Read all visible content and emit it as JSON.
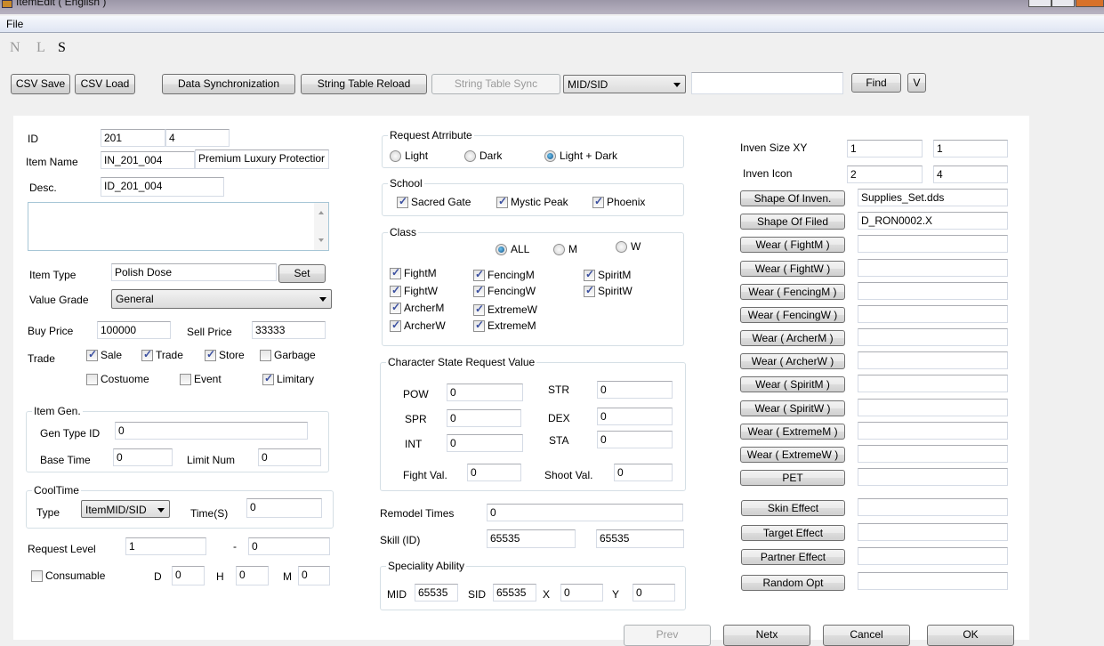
{
  "window": {
    "title": "ItemEdit ( English )"
  },
  "menu": {
    "file": "File"
  },
  "mode": {
    "n": "N",
    "l": "L",
    "s": "S"
  },
  "toolbar": {
    "csv_save": "CSV Save",
    "csv_load": "CSV Load",
    "data_sync": "Data Synchronization",
    "string_reload": "String Table Reload",
    "string_sync": "String Table Sync",
    "search_type": "MID/SID",
    "search_value": "",
    "find": "Find",
    "v": "V"
  },
  "left": {
    "id_label": "ID",
    "id_main": "201",
    "id_sub": "4",
    "name_label": "Item Name",
    "name_key": "IN_201_004",
    "name_value": "Premium Luxury Protectior",
    "desc_label": "Desc.",
    "desc_key": "ID_201_004",
    "desc_text": "",
    "type_label": "Item Type",
    "type_value": "Polish Dose",
    "set": "Set",
    "grade_label": "Value Grade",
    "grade_value": "General",
    "buy_label": "Buy Price",
    "buy_value": "100000",
    "sell_label": "Sell Price",
    "sell_value": "33333",
    "trade_label": "Trade",
    "trade": [
      {
        "label": "Sale",
        "checked": true
      },
      {
        "label": "Trade",
        "checked": true
      },
      {
        "label": "Store",
        "checked": true
      },
      {
        "label": "Garbage",
        "checked": false
      },
      {
        "label": "Costuome",
        "checked": false
      },
      {
        "label": "Event",
        "checked": false
      },
      {
        "label": "Limitary",
        "checked": true
      }
    ],
    "gen": {
      "title": "Item Gen.",
      "gen_type_label": "Gen Type ID",
      "gen_type": "0",
      "base_time_label": "Base Time",
      "base_time": "0",
      "limit_label": "Limit Num",
      "limit": "0"
    },
    "cool": {
      "title": "CoolTime",
      "type_label": "Type",
      "type_value": "ItemMID/SID",
      "time_label": "Time(S)",
      "time": "0"
    },
    "req_level_label": "Request Level",
    "req_level_min": "1",
    "dash": "-",
    "req_level_max": "0",
    "consumable": {
      "label": "Consumable",
      "checked": false
    },
    "d_label": "D",
    "d": "0",
    "h_label": "H",
    "h": "0",
    "m_label": "M",
    "m": "0"
  },
  "middle": {
    "attr": {
      "title": "Request Atrribute",
      "options": [
        {
          "label": "Light",
          "selected": false
        },
        {
          "label": "Dark",
          "selected": false
        },
        {
          "label": "Light + Dark",
          "selected": true
        }
      ]
    },
    "school": {
      "title": "School",
      "items": [
        {
          "label": "Sacred Gate",
          "checked": true
        },
        {
          "label": "Mystic Peak",
          "checked": true
        },
        {
          "label": "Phoenix",
          "checked": true
        }
      ]
    },
    "class": {
      "title": "Class",
      "gender": [
        {
          "label": "ALL",
          "selected": true
        },
        {
          "label": "M",
          "selected": false
        },
        {
          "label": "W",
          "selected": false
        }
      ],
      "items": [
        {
          "label": "FightM",
          "checked": true
        },
        {
          "label": "FightW",
          "checked": true
        },
        {
          "label": "ArcherM",
          "checked": true
        },
        {
          "label": "ArcherW",
          "checked": true
        },
        {
          "label": "FencingM",
          "checked": true
        },
        {
          "label": "FencingW",
          "checked": true
        },
        {
          "label": "ExtremeW",
          "checked": true
        },
        {
          "label": "ExtremeM",
          "checked": true
        },
        {
          "label": "SpiritM",
          "checked": true
        },
        {
          "label": "SpiritW",
          "checked": true
        }
      ]
    },
    "state": {
      "title": "Character State Request Value",
      "pow_label": "POW",
      "pow": "0",
      "str_label": "STR",
      "str": "0",
      "spr_label": "SPR",
      "spr": "0",
      "dex_label": "DEX",
      "dex": "0",
      "int_label": "INT",
      "int": "0",
      "sta_label": "STA",
      "sta": "0",
      "fight_label": "Fight Val.",
      "fight": "0",
      "shoot_label": "Shoot Val.",
      "shoot": "0"
    },
    "remodel_label": "Remodel Times",
    "remodel": "0",
    "skill_label": "Skill (ID)",
    "skill_1": "65535",
    "skill_2": "65535",
    "spec": {
      "title": "Speciality Ability",
      "mid_label": "MID",
      "mid": "65535",
      "sid_label": "SID",
      "sid": "65535",
      "x_label": "X",
      "x": "0",
      "y_label": "Y",
      "y": "0"
    }
  },
  "right": {
    "size_label": "Inven Size XY",
    "size_x": "1",
    "size_y": "1",
    "icon_label": "Inven Icon",
    "icon_x": "2",
    "icon_y": "4",
    "rows": [
      {
        "button": "Shape Of Inven.",
        "value": "Supplies_Set.dds"
      },
      {
        "button": "Shape Of Filed",
        "value": "D_RON0002.X"
      },
      {
        "button": "Wear ( FightM )",
        "value": ""
      },
      {
        "button": "Wear ( FightW )",
        "value": ""
      },
      {
        "button": "Wear ( FencingM )",
        "value": ""
      },
      {
        "button": "Wear ( FencingW )",
        "value": ""
      },
      {
        "button": "Wear ( ArcherM )",
        "value": ""
      },
      {
        "button": "Wear ( ArcherW )",
        "value": ""
      },
      {
        "button": "Wear ( SpiritM )",
        "value": ""
      },
      {
        "button": "Wear ( SpiritW )",
        "value": ""
      },
      {
        "button": "Wear ( ExtremeM )",
        "value": ""
      },
      {
        "button": "Wear ( ExtremeW )",
        "value": ""
      },
      {
        "button": "PET",
        "value": ""
      },
      {
        "button": "Skin Effect",
        "value": ""
      },
      {
        "button": "Target Effect",
        "value": ""
      },
      {
        "button": "Partner Effect",
        "value": ""
      },
      {
        "button": "Random Opt",
        "value": ""
      }
    ]
  },
  "footer": {
    "prev": "Prev",
    "next": "Netx",
    "cancel": "Cancel",
    "ok": "OK"
  }
}
